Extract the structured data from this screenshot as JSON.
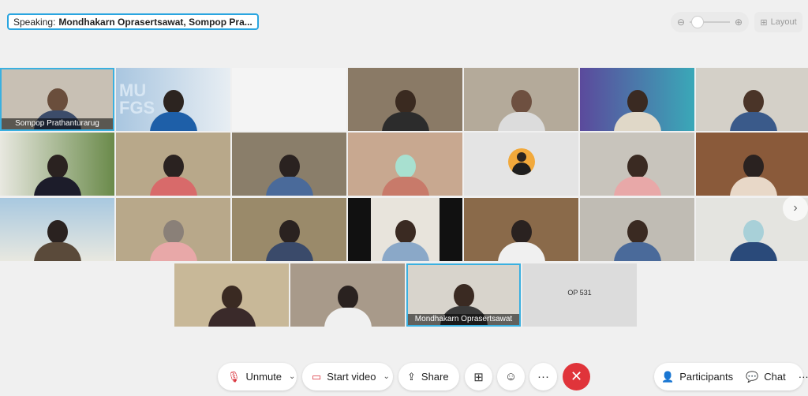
{
  "header": {
    "speaking_prefix": "Speaking:",
    "speaking_names": "Mondhakarn Oprasertsawat, Sompop Pra...",
    "layout_label": "Layout"
  },
  "tiles": {
    "sompop_name": "Sompop Prathanturarug",
    "mufgs_text_top": "MU",
    "mufgs_text_bottom": "FGS",
    "mondhakarn_name": "Mondhakarn Oprasertsawat",
    "op_label": "OP 531"
  },
  "toolbar": {
    "unmute_label": "Unmute",
    "start_video_label": "Start video",
    "share_label": "Share",
    "more_label": "···",
    "participants_label": "Participants",
    "chat_label": "Chat",
    "overflow_label": "···"
  },
  "colors": {
    "accent": "#2aa5e0",
    "end_call": "#e0343a",
    "muted_icon": "#d9303a"
  }
}
